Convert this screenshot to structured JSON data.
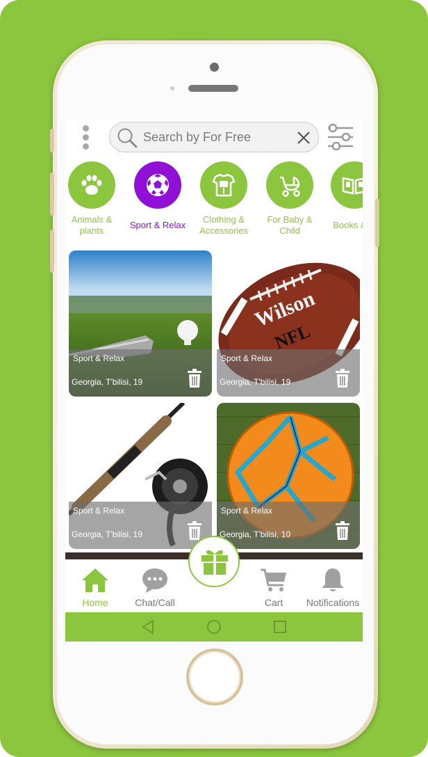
{
  "search": {
    "placeholder": "Search by For Free"
  },
  "categories": [
    {
      "label_lines": [
        "Animals &",
        "plants"
      ],
      "icon": "paw-icon",
      "active": false
    },
    {
      "label_lines": [
        "Sport & Relax"
      ],
      "icon": "soccer-ball-icon",
      "active": true
    },
    {
      "label_lines": [
        "Clothing &",
        "Accessories"
      ],
      "icon": "clothing-icon",
      "active": false
    },
    {
      "label_lines": [
        "For Baby &",
        "Child"
      ],
      "icon": "stroller-icon",
      "active": false
    },
    {
      "label_lines": [
        "Books & C"
      ],
      "icon": "books-icon",
      "active": false
    }
  ],
  "listings": [
    {
      "category": "Sport & Relax",
      "location": "Georgia, T'bilisi, 19",
      "image": "golf-club-and-ball"
    },
    {
      "category": "Sport & Relax",
      "location": "Georgia, T'bilisi, 19",
      "image": "wilson-nfl-football"
    },
    {
      "category": "Sport & Relax",
      "location": "Georgia, T'bilisi, 19",
      "image": "fishing-rod-reel"
    },
    {
      "category": "Sport & Relax",
      "location": "Georgia, T'bilisi, 10",
      "image": "orange-soccer-ball"
    }
  ],
  "nav": {
    "home": "Home",
    "chat": "Chat/Call",
    "cart": "Cart",
    "notifications": "Notifications"
  },
  "colors": {
    "accent": "#8cc63f",
    "active_category": "#9010d6",
    "inactive_nav": "#a0a0a0"
  }
}
